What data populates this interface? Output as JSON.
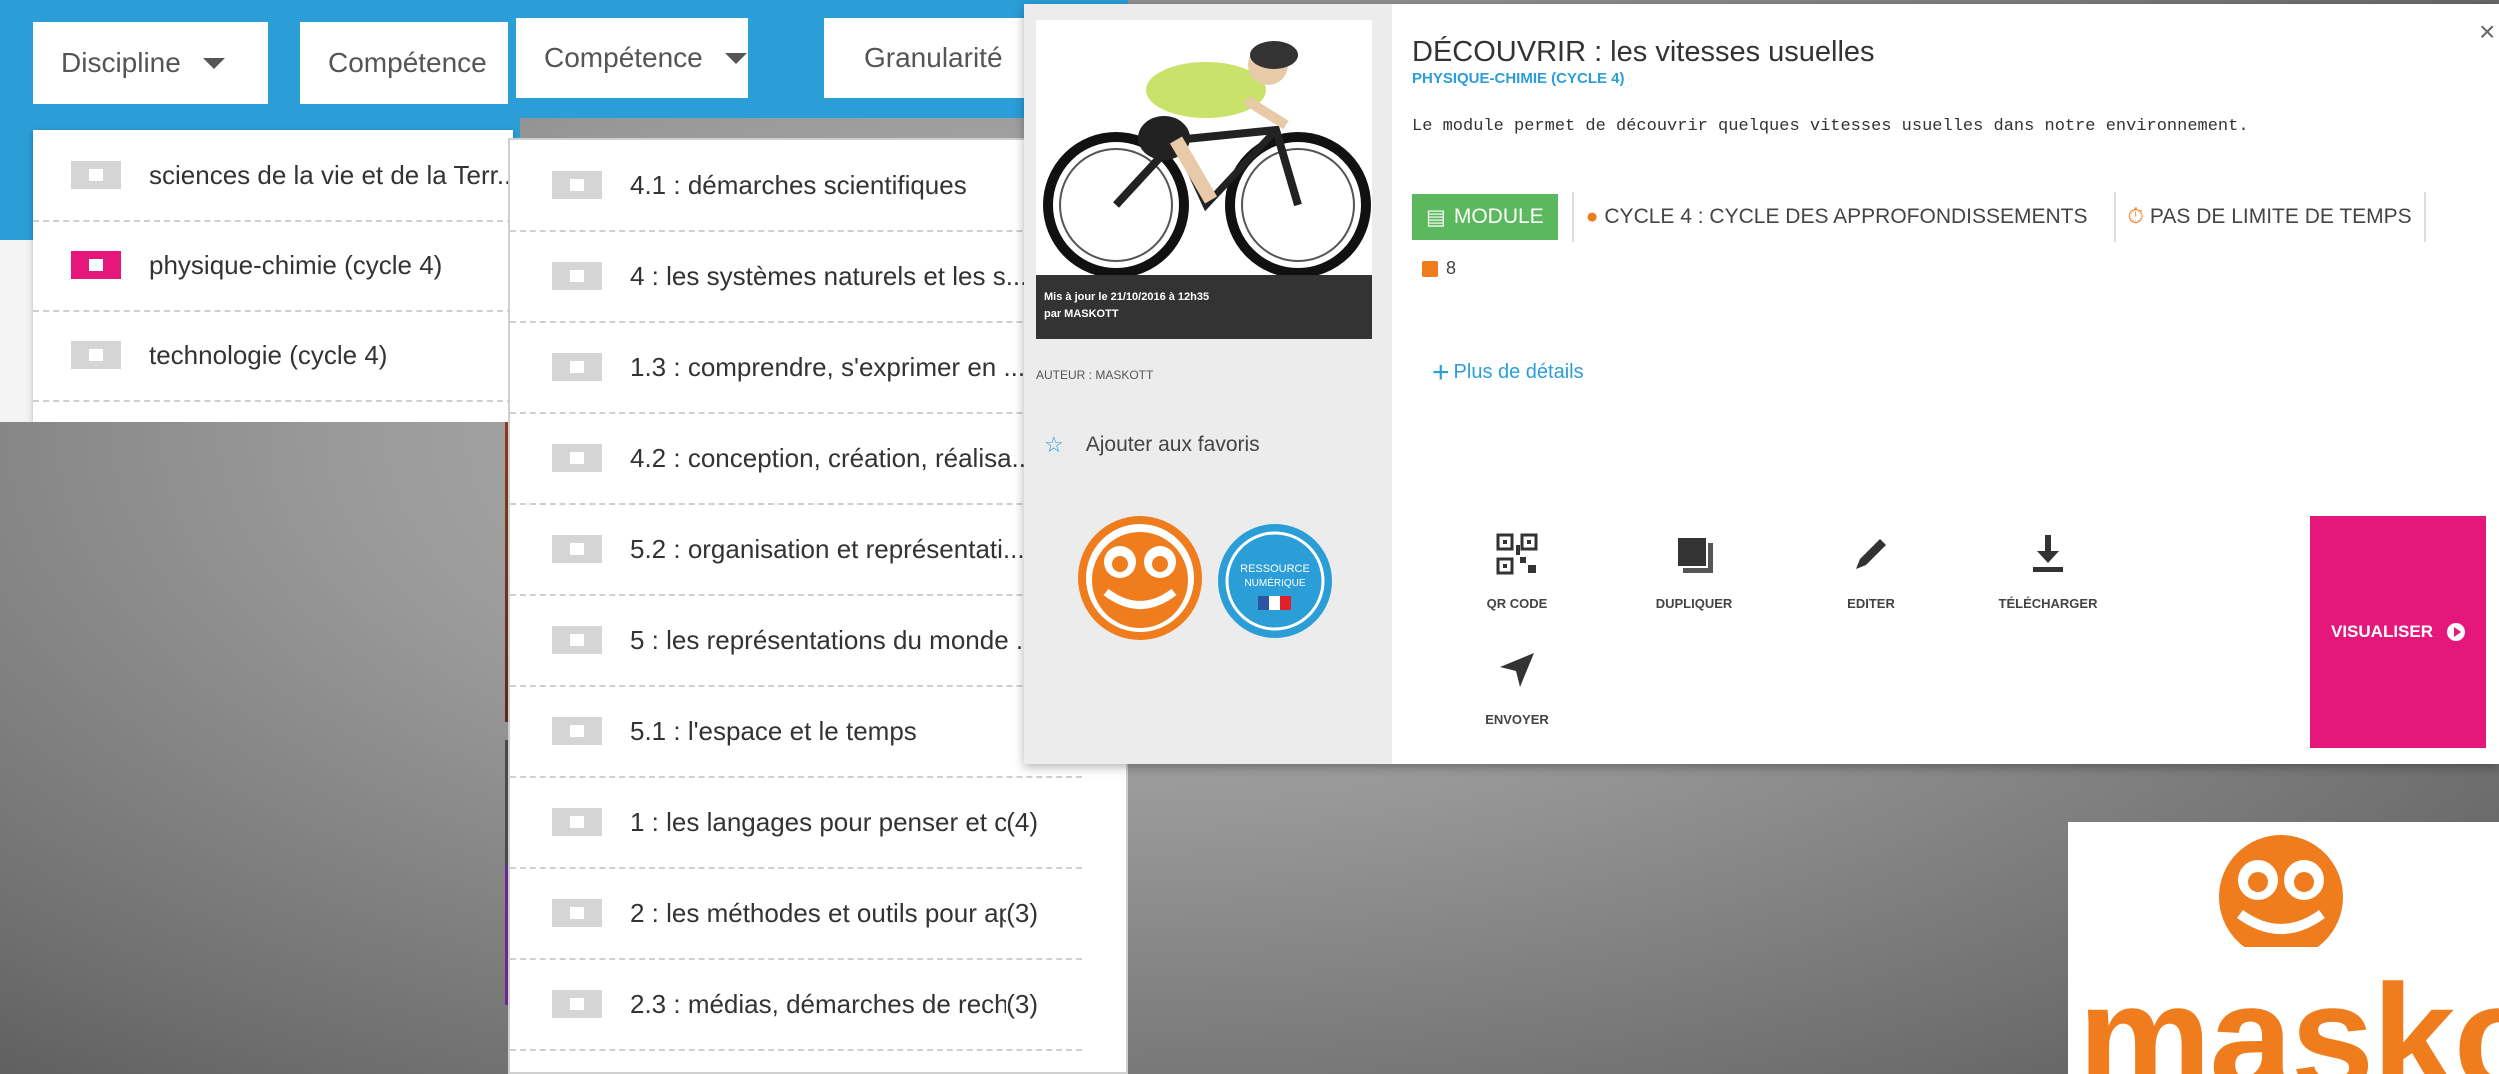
{
  "filters": {
    "discipline_label": "Discipline",
    "competence_label": "Compétence",
    "competence_dropdown_label": "Compétence",
    "granularite_label": "Granularité"
  },
  "discipline_options": [
    {
      "label": "sciences de la vie et de la Terr...",
      "checked": false
    },
    {
      "label": "physique-chimie (cycle 4)",
      "checked": true
    },
    {
      "label": "technologie (cycle 4)",
      "checked": false
    }
  ],
  "competence_options": [
    {
      "label": "4.1 : démarches scientifiques",
      "count": ""
    },
    {
      "label": "4 : les systèmes naturels et les s...",
      "count": ""
    },
    {
      "label": "1.3 : comprendre, s'exprimer en ...",
      "count": ""
    },
    {
      "label": "4.2 : conception, création, réalisa...",
      "count": ""
    },
    {
      "label": "5.2 : organisation et représentati...",
      "count": ""
    },
    {
      "label": "5 : les représentations du monde ...",
      "count": ""
    },
    {
      "label": "5.1 : l'espace et le temps",
      "count": ""
    },
    {
      "label": "1 : les langages pour penser et co...",
      "count": "(4)"
    },
    {
      "label": "2 : les méthodes et outils pour ap...",
      "count": "(3)"
    },
    {
      "label": "2.3 : médias, démarches de reche...",
      "count": "(3)"
    }
  ],
  "resource": {
    "title": "DÉCOUVRIR : les vitesses usuelles",
    "subtitle": "PHYSIQUE-CHIMIE (CYCLE 4)",
    "description": "Le module permet de découvrir quelques vitesses usuelles dans notre environnement.",
    "tag_module": "MODULE",
    "tag_cycle": "CYCLE 4 : CYCLE DES APPROFONDISSEMENTS",
    "tag_time": "PAS DE LIMITE DE TEMPS",
    "count": "8",
    "more_details": "Plus de détails",
    "updated_line1": "Mis à jour le 21/10/2016 à 12h35",
    "updated_line2": "par MASKOTT",
    "author": "AUTEUR : MASKOTT",
    "favorite": "Ajouter aux favoris",
    "badge_line1": "RESSOURCE",
    "badge_line2": "NUMÉRIQUE",
    "close": "×",
    "visualize": "VISUALISER"
  },
  "actions": [
    {
      "label": "QR CODE",
      "icon": "qr-code-icon"
    },
    {
      "label": "DUPLIQUER",
      "icon": "copy-icon"
    },
    {
      "label": "EDITER",
      "icon": "pencil-icon"
    },
    {
      "label": "TÉLÉCHARGER",
      "icon": "download-icon"
    },
    {
      "label": "ENVOYER",
      "icon": "send-icon"
    }
  ],
  "logo": {
    "text": "maskott",
    "color": "#ef7d1e"
  },
  "colors": {
    "blue": "#2b9ed8",
    "pink": "#e6177a",
    "green": "#5cb85c",
    "orange": "#ef7d1e"
  }
}
